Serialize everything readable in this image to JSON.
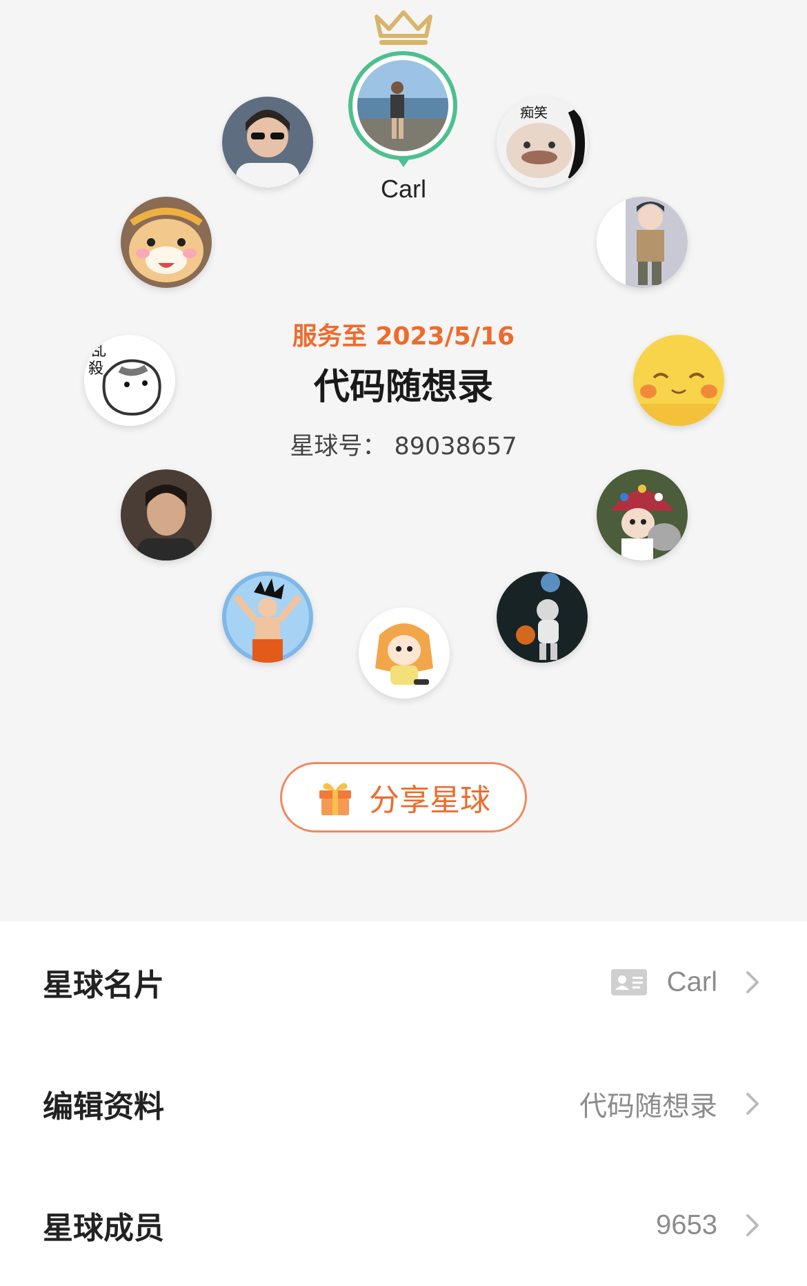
{
  "owner": {
    "name": "Carl"
  },
  "planet": {
    "service_until": "服务至 2023/5/16",
    "name": "代码随想录",
    "id_label": "星球号：",
    "id_value": "89038657",
    "id_text": "星球号： 89038657"
  },
  "share": {
    "label": "分享星球",
    "icon": "gift-icon"
  },
  "members_avatars": [
    {
      "name": "sunglasses-guy"
    },
    {
      "name": "laughing-face",
      "caption": "痴笑"
    },
    {
      "name": "shiba-dog"
    },
    {
      "name": "anime-character"
    },
    {
      "name": "ink-dog",
      "caption": "乱 殺"
    },
    {
      "name": "pikachu-face"
    },
    {
      "name": "young-man"
    },
    {
      "name": "doll-with-hat"
    },
    {
      "name": "goku"
    },
    {
      "name": "umaru-chan"
    },
    {
      "name": "astronaut-basketball"
    }
  ],
  "menu": [
    {
      "title": "星球名片",
      "value": "Carl",
      "icon": "id-card-icon"
    },
    {
      "title": "编辑资料",
      "value": "代码随想录"
    },
    {
      "title": "星球成员",
      "value": "9653"
    }
  ],
  "colors": {
    "accent": "#ee6b2c",
    "owner_ring": "#4cc08f",
    "crown": "#d9b46a"
  }
}
